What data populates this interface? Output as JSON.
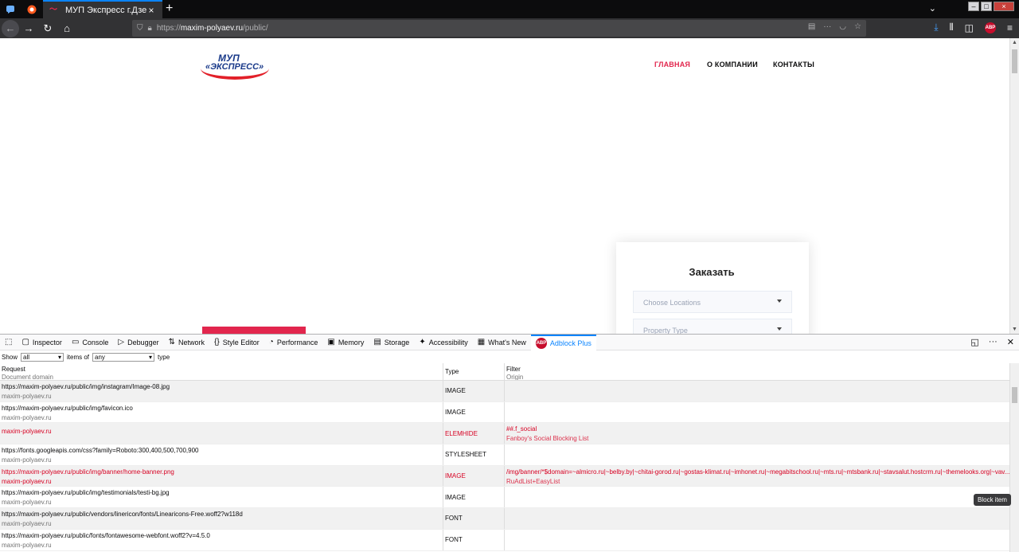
{
  "browser": {
    "tab_title": "МУП Экспресс г.Дзержинск",
    "tab_close": "×",
    "new_tab": "+",
    "url_scheme": "https://",
    "url_host": "maxim-polyaev.ru",
    "url_path": "/public/",
    "url_more": "···",
    "abp_badge": "ABP"
  },
  "page": {
    "logo_line1": "МУП",
    "logo_line2": "«ЭКСПРЕСС»",
    "menu": [
      "ГЛАВНАЯ",
      "О КОМПАНИИ",
      "КОНТАКТЫ"
    ],
    "order_title": "Заказать",
    "select1": "Choose Locations",
    "select2": "Property Type"
  },
  "devtools": {
    "tabs": [
      "Inspector",
      "Console",
      "Debugger",
      "Network",
      "Style Editor",
      "Performance",
      "Memory",
      "Storage",
      "Accessibility",
      "What's New",
      "Adblock Plus"
    ],
    "filter": {
      "show": "Show",
      "show_value": "all",
      "items_of": "items of",
      "type_value": "any",
      "type": "type"
    },
    "headers": {
      "request": "Request",
      "document_domain": "Document domain",
      "type": "Type",
      "filter": "Filter",
      "origin": "Origin"
    },
    "rows": [
      {
        "request": "https://maxim-polyaev.ru/public/img/instagram/Image-08.jpg",
        "domain": "maxim-polyaev.ru",
        "type": "IMAGE",
        "filter": "",
        "origin": ""
      },
      {
        "request": "https://maxim-polyaev.ru/public/img/favicon.ico",
        "domain": "maxim-polyaev.ru",
        "type": "IMAGE",
        "filter": "",
        "origin": ""
      },
      {
        "request": "",
        "domain": "maxim-polyaev.ru",
        "type": "ELEMHIDE",
        "filter": "##.f_social",
        "origin": "Fanboy's Social Blocking List"
      },
      {
        "request": "https://fonts.googleapis.com/css?family=Roboto:300,400,500,700,900",
        "domain": "maxim-polyaev.ru",
        "type": "STYLESHEET",
        "filter": "",
        "origin": ""
      },
      {
        "request": "https://maxim-polyaev.ru/public/img/banner/home-banner.png",
        "domain": "maxim-polyaev.ru",
        "type": "IMAGE",
        "filter": "/img/banner/*$domain=~almicro.ru|~belby.by|~chitai-gorod.ru|~gostas-klimat.ru|~imhonet.ru|~megabitschool.ru|~mts.ru|~mtsbank.ru|~stavsalut.hostcrm.ru|~themelooks.org|~vav...",
        "origin": "RuAdList+EasyList"
      },
      {
        "request": "https://maxim-polyaev.ru/public/img/testimonials/testi-bg.jpg",
        "domain": "maxim-polyaev.ru",
        "type": "IMAGE",
        "filter": "",
        "origin": ""
      },
      {
        "request": "https://maxim-polyaev.ru/public/vendors/linericon/fonts/Linearicons-Free.woff2?w118d",
        "domain": "maxim-polyaev.ru",
        "type": "FONT",
        "filter": "",
        "origin": ""
      },
      {
        "request": "https://maxim-polyaev.ru/public/fonts/fontawesome-webfont.woff2?v=4.5.0",
        "domain": "maxim-polyaev.ru",
        "type": "FONT",
        "filter": "",
        "origin": ""
      }
    ],
    "tooltip": "Block item"
  }
}
